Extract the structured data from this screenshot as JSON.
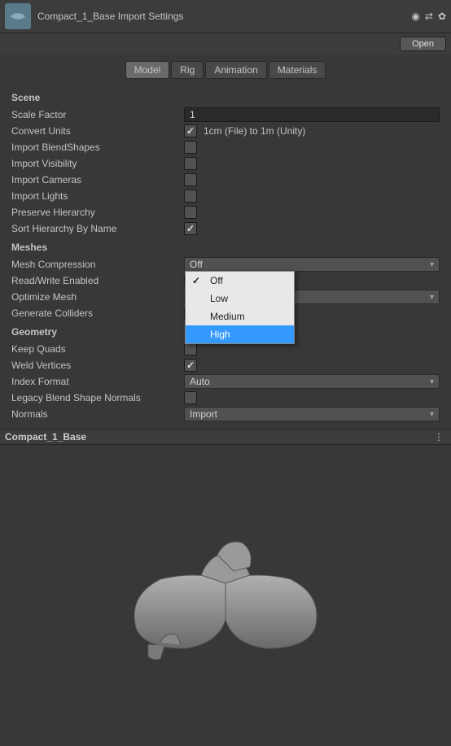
{
  "header": {
    "title": "Compact_1_Base Import Settings",
    "open_label": "Open"
  },
  "tabs": {
    "model": "Model",
    "rig": "Rig",
    "animation": "Animation",
    "materials": "Materials",
    "active": "Model"
  },
  "scene": {
    "heading": "Scene",
    "scale_factor_label": "Scale Factor",
    "scale_factor_value": "1",
    "convert_units_label": "Convert Units",
    "convert_units_checked": true,
    "convert_units_note": "1cm (File) to 1m (Unity)",
    "import_blendshapes_label": "Import BlendShapes",
    "import_visibility_label": "Import Visibility",
    "import_cameras_label": "Import Cameras",
    "import_lights_label": "Import Lights",
    "preserve_hierarchy_label": "Preserve Hierarchy",
    "sort_hierarchy_label": "Sort Hierarchy By Name",
    "sort_hierarchy_checked": true
  },
  "meshes": {
    "heading": "Meshes",
    "mesh_compression_label": "Mesh Compression",
    "mesh_compression_value": "Off",
    "mesh_compression_options": {
      "off": "Off",
      "low": "Low",
      "medium": "Medium",
      "high": "High"
    },
    "read_write_label": "Read/Write Enabled",
    "optimize_mesh_label": "Optimize Mesh",
    "generate_colliders_label": "Generate Colliders"
  },
  "geometry": {
    "heading": "Geometry",
    "keep_quads_label": "Keep Quads",
    "weld_vertices_label": "Weld Vertices",
    "weld_vertices_checked": true,
    "index_format_label": "Index Format",
    "index_format_value": "Auto",
    "legacy_blend_label": "Legacy Blend Shape Normals",
    "normals_label": "Normals",
    "normals_value": "Import"
  },
  "preview": {
    "title": "Compact_1_Base"
  }
}
